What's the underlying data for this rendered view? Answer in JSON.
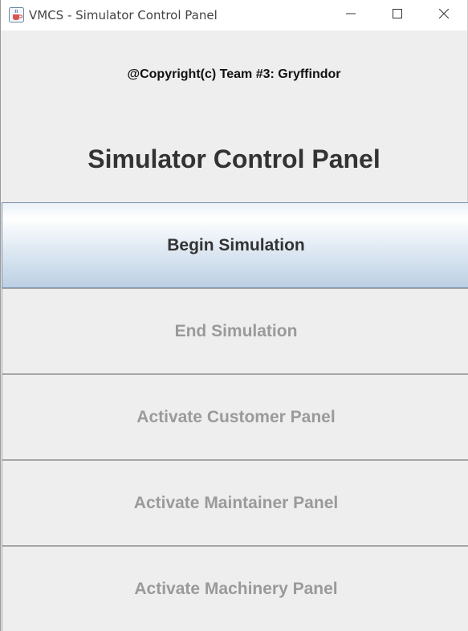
{
  "window": {
    "title": "VMCS - Simulator Control Panel",
    "app_icon": "java-cup-icon",
    "controls": [
      "minimize-icon",
      "maximize-icon",
      "close-icon"
    ]
  },
  "header": {
    "copyright": "@Copyright(c) Team #3: Gryffindor",
    "title": "Simulator Control Panel"
  },
  "buttons": [
    {
      "label": "Begin Simulation",
      "enabled": true
    },
    {
      "label": "End Simulation",
      "enabled": false
    },
    {
      "label": "Activate Customer Panel",
      "enabled": false
    },
    {
      "label": "Activate Maintainer Panel",
      "enabled": false
    },
    {
      "label": "Activate Machinery Panel",
      "enabled": false
    }
  ],
  "colors": {
    "background": "#eeeeee",
    "enabled_text": "#333333",
    "disabled_text": "#9a9a9a",
    "accent_gradient_bottom": "#bcd0e4"
  }
}
